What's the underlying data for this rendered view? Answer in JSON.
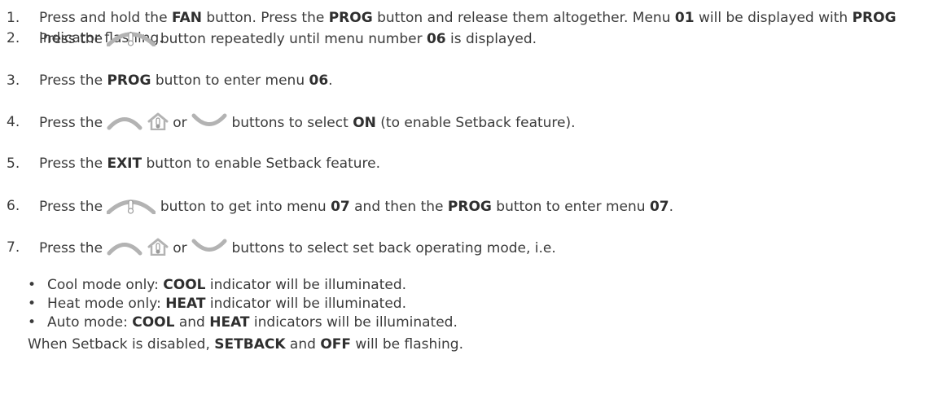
{
  "steps": [
    {
      "number": "1.",
      "segments": [
        {
          "t": "Press and hold the "
        },
        {
          "t": "FAN",
          "b": true
        },
        {
          "t": " button. Press the "
        },
        {
          "t": "PROG",
          "b": true
        },
        {
          "t": " button and release them altogether. Menu "
        },
        {
          "t": "01",
          "b": true
        },
        {
          "t": " will be displayed with "
        },
        {
          "t": "PROG",
          "b": true
        },
        {
          "t": " indicator flashing."
        }
      ]
    },
    {
      "number": "2.",
      "segments": [
        {
          "t": "Press the "
        },
        {
          "icon": "arrow-up-thermometer-icon"
        },
        {
          "t": " button repeatedly until menu number "
        },
        {
          "t": "06",
          "b": true
        },
        {
          "t": " is displayed."
        }
      ]
    },
    {
      "number": "3.",
      "segments": [
        {
          "t": "Press the "
        },
        {
          "t": "PROG",
          "b": true
        },
        {
          "t": " button to enter menu "
        },
        {
          "t": "06",
          "b": true
        },
        {
          "t": "."
        }
      ]
    },
    {
      "number": "4.",
      "segments": [
        {
          "t": "Press the "
        },
        {
          "icon": "arrow-up-icon"
        },
        {
          "t": " "
        },
        {
          "icon": "house-thermometer-icon"
        },
        {
          "t": " or "
        },
        {
          "icon": "arrow-down-icon"
        },
        {
          "t": " buttons to select "
        },
        {
          "t": "ON",
          "b": true
        },
        {
          "t": " (to enable Setback feature)."
        }
      ]
    },
    {
      "number": "5.",
      "segments": [
        {
          "t": "Press the "
        },
        {
          "t": "EXIT",
          "b": true
        },
        {
          "t": " button to enable Setback feature."
        }
      ]
    },
    {
      "number": "6.",
      "segments": [
        {
          "t": "Press the "
        },
        {
          "icon": "arrow-up-thermometer-icon"
        },
        {
          "t": " button to get into menu "
        },
        {
          "t": "07",
          "b": true
        },
        {
          "t": " and then the "
        },
        {
          "t": "PROG",
          "b": true
        },
        {
          "t": " button to enter menu "
        },
        {
          "t": "07",
          "b": true
        },
        {
          "t": "."
        }
      ]
    },
    {
      "number": "7.",
      "segments": [
        {
          "t": "Press the "
        },
        {
          "icon": "arrow-up-icon"
        },
        {
          "t": " "
        },
        {
          "icon": "house-thermometer-icon"
        },
        {
          "t": " or "
        },
        {
          "icon": "arrow-down-icon"
        },
        {
          "t": " buttons to select set back operating mode, i.e."
        }
      ]
    }
  ],
  "bullets": [
    {
      "segments": [
        {
          "t": "Cool mode only: "
        },
        {
          "t": "COOL",
          "b": true
        },
        {
          "t": " indicator will be illuminated."
        }
      ]
    },
    {
      "segments": [
        {
          "t": "Heat mode only: "
        },
        {
          "t": "HEAT",
          "b": true
        },
        {
          "t": " indicator will be illuminated."
        }
      ]
    },
    {
      "segments": [
        {
          "t": "Auto mode: "
        },
        {
          "t": "COOL",
          "b": true
        },
        {
          "t": " and "
        },
        {
          "t": "HEAT",
          "b": true
        },
        {
          "t": " indicators will be illuminated."
        }
      ]
    }
  ],
  "bullet_symbol": "•",
  "note": {
    "segments": [
      {
        "t": "When Setback is disabled, "
      },
      {
        "t": "SETBACK",
        "b": true
      },
      {
        "t": " and "
      },
      {
        "t": "OFF",
        "b": true
      },
      {
        "t": " will be flashing."
      }
    ]
  },
  "colors": {
    "text": "#3b3b3b",
    "icon": "#b3b3b3",
    "icon_accent": "#9a9a9a"
  }
}
